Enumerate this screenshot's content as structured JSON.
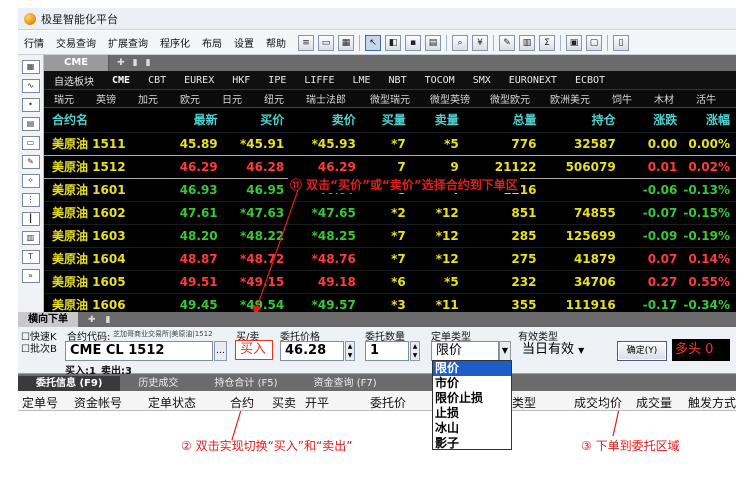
{
  "app": {
    "title": "极星智能化平台"
  },
  "menu": [
    "行情",
    "交易查询",
    "扩展查询",
    "程序化",
    "布局",
    "设置",
    "帮助"
  ],
  "quote_tab": "CME",
  "exchanges": [
    "自选板块",
    "CME",
    "CBT",
    "EUREX",
    "HKF",
    "IPE",
    "LIFFE",
    "LME",
    "NBT",
    "TOCOM",
    "SMX",
    "EURONEXT",
    "ECBOT"
  ],
  "currencies": [
    "瑞元",
    "英镑",
    "加元",
    "欧元",
    "日元",
    "纽元",
    "瑞士法郎",
    "微型瑞元",
    "微型英镑",
    "微型欧元",
    "欧洲美元",
    "饲牛",
    "木材",
    "活牛"
  ],
  "quote_headers": [
    "合约名",
    "最新",
    "买价",
    "卖价",
    "买量",
    "卖量",
    "总量",
    "持仓",
    "涨跌",
    "涨幅"
  ],
  "quotes": [
    {
      "name": "美原油 1511",
      "last": "45.89",
      "bid": "*45.91",
      "ask": "*45.93",
      "bid_qty": "*7",
      "ask_qty": "*5",
      "volume": "776",
      "oi": "32587",
      "change": "0.00",
      "pct": "0.00%",
      "trend": "flat"
    },
    {
      "name": "美原油 1512",
      "last": "46.29",
      "bid": "46.28",
      "ask": "46.29",
      "bid_qty": "7",
      "ask_qty": "9",
      "volume": "21122",
      "oi": "506079",
      "change": "0.01",
      "pct": "0.02%",
      "trend": "up"
    },
    {
      "name": "美原油 1601",
      "last": "46.93",
      "bid": "46.95",
      "ask": "*46.97",
      "bid_qty": "*8",
      "ask_qty": "*4",
      "volume": "1216",
      "oi": "",
      "change": "-0.06",
      "pct": "-0.13%",
      "trend": "down"
    },
    {
      "name": "美原油 1602",
      "last": "47.61",
      "bid": "*47.63",
      "ask": "*47.65",
      "bid_qty": "*2",
      "ask_qty": "*12",
      "volume": "851",
      "oi": "74855",
      "change": "-0.07",
      "pct": "-0.15%",
      "trend": "down"
    },
    {
      "name": "美原油 1603",
      "last": "48.20",
      "bid": "*48.22",
      "ask": "*48.25",
      "bid_qty": "*7",
      "ask_qty": "*12",
      "volume": "285",
      "oi": "125699",
      "change": "-0.09",
      "pct": "-0.19%",
      "trend": "down"
    },
    {
      "name": "美原油 1604",
      "last": "48.87",
      "bid": "*48.72",
      "ask": "*48.76",
      "bid_qty": "*7",
      "ask_qty": "*12",
      "volume": "275",
      "oi": "41879",
      "change": "0.07",
      "pct": "0.14%",
      "trend": "up"
    },
    {
      "name": "美原油 1605",
      "last": "49.51",
      "bid": "*49.15",
      "ask": "49.18",
      "bid_qty": "*6",
      "ask_qty": "*5",
      "volume": "232",
      "oi": "34706",
      "change": "0.27",
      "pct": "0.55%",
      "trend": "up"
    },
    {
      "name": "美原油 1606",
      "last": "49.45",
      "bid": "*49.54",
      "ask": "*49.57",
      "bid_qty": "*3",
      "ask_qty": "*11",
      "volume": "355",
      "oi": "111916",
      "change": "-0.17",
      "pct": "-0.34%",
      "trend": "down"
    }
  ],
  "annotations": {
    "a1": "⑪ 双击“买价”或“卖价”选择合约到下单区",
    "a2": "② 双击实现切换“买入”和“卖出”",
    "a3": "③ 下单到委托区域"
  },
  "order": {
    "tab": "横向下单",
    "quick_label": "快速K",
    "batch_label": "批次B",
    "code_label": "合约代码:",
    "code_hint": "芝加哥商业交易所|美原油|1512",
    "code_value": "CME CL 1512",
    "side_label": "买/卖",
    "side_value": "买入",
    "price_label": "委托价格",
    "price_value": "46.28",
    "qty_label": "委托数量",
    "qty_value": "1",
    "type_label": "定单类型",
    "type_value": "限价",
    "valid_label": "有效类型",
    "valid_value": "当日有效",
    "confirm": "确定(Y)",
    "position": "多头 0",
    "buy_in": "买入:1",
    "sell_out": "卖出:3",
    "type_options": [
      "限价",
      "市价",
      "限价止损",
      "止损",
      "冰山",
      "影子"
    ]
  },
  "lower_tabs": [
    "委托信息 (F9)",
    "历史成交",
    "持仓合计 (F5)",
    "资金查询 (F7)"
  ],
  "grid_headers": [
    "定单号",
    "资金帐号",
    "定单状态",
    "合约",
    "买卖",
    "开平",
    "委托价",
    "类型",
    "成交均价",
    "成交量",
    "触发方式"
  ],
  "colors": {
    "up": "#ff3b3b",
    "down": "#37c837",
    "flat": "#e8e020",
    "header": "#4fd0d0",
    "annotation": "#e81b1b"
  }
}
